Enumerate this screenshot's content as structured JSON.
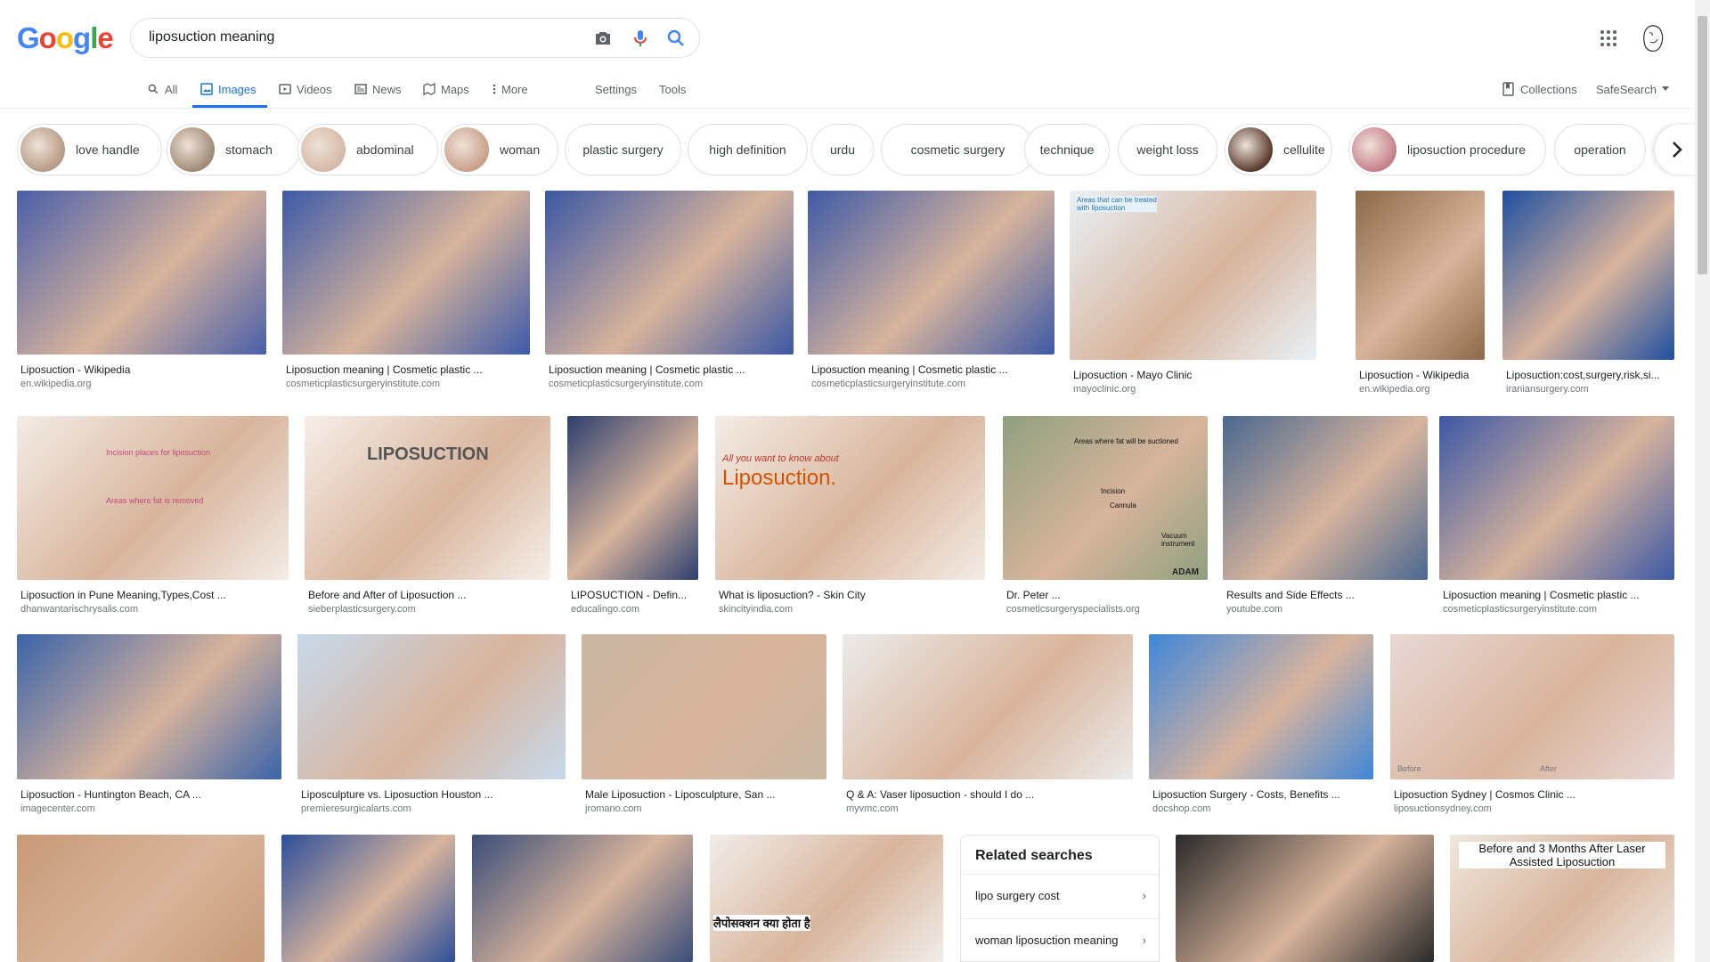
{
  "header": {
    "logo_letters": [
      "G",
      "o",
      "o",
      "g",
      "l",
      "e"
    ],
    "logo_colors": [
      "#4285F4",
      "#EA4335",
      "#FBBC05",
      "#4285F4",
      "#34A853",
      "#EA4335"
    ],
    "query": "liposuction meaning",
    "camera_icon": "camera-icon",
    "mic_icon": "mic-icon",
    "search_icon": "search-icon",
    "apps_icon": "apps-grid-icon",
    "avatar_icon": "avatar"
  },
  "nav": {
    "all": "All",
    "images": "Images",
    "videos": "Videos",
    "news": "News",
    "maps": "Maps",
    "more": "More",
    "settings": "Settings",
    "tools": "Tools",
    "collections": "Collections",
    "safesearch": "SafeSearch",
    "accent": "#1a73e8"
  },
  "chips": [
    {
      "label": "love handle",
      "thumb": "#b89a86"
    },
    {
      "label": "stomach",
      "thumb": "#9e8a76"
    },
    {
      "label": "abdominal",
      "thumb": "#d5b8a6"
    },
    {
      "label": "woman",
      "thumb": "#c9a08a"
    },
    {
      "label": "plastic surgery"
    },
    {
      "label": "high definition"
    },
    {
      "label": "urdu"
    },
    {
      "label": "cosmetic surgery"
    },
    {
      "label": "technique"
    },
    {
      "label": "weight loss"
    },
    {
      "label": "cellulite",
      "thumb": "#5a3a2e"
    },
    {
      "label": "liposuction procedure",
      "thumb": "#c77f8a"
    },
    {
      "label": "operation"
    }
  ],
  "results": [
    {
      "title": "Liposuction - Wikipedia",
      "domain": "en.wikipedia.org",
      "color": "#4a5fa8"
    },
    {
      "title": "Liposuction meaning | Cosmetic plastic ...",
      "domain": "cosmeticplasticsurgeryinstitute.com",
      "color": "#3d5aa8"
    },
    {
      "title": "Liposuction meaning | Cosmetic plastic ...",
      "domain": "cosmeticplasticsurgeryinstitute.com",
      "color": "#3b57a3"
    },
    {
      "title": "Liposuction meaning | Cosmetic plastic ...",
      "domain": "cosmeticplasticsurgeryinstitute.com",
      "color": "#3e5aa6"
    },
    {
      "title": "Liposuction - Mayo Clinic",
      "domain": "mayoclinic.org",
      "color": "#e9f1f7"
    },
    {
      "title": "Liposuction - Wikipedia",
      "domain": "en.wikipedia.org",
      "color": "#8a6a4a"
    },
    {
      "title": "Liposuction:cost,surgery,risk,si...",
      "domain": "iraniansurgery.com",
      "color": "#1f4fa0"
    },
    {
      "title": "Liposuction in Pune Meaning,Types,Cost ...",
      "domain": "dhanwantarischrysalis.com",
      "color": "#f3ece6"
    },
    {
      "title": "Before and After of Liposuction ...",
      "domain": "sieberplasticsurgery.com",
      "color": "#f6efe9"
    },
    {
      "title": "LIPOSUCTION - Defin...",
      "domain": "educalingo.com",
      "color": "#2c3f6e"
    },
    {
      "title": "What is liposuction? - Skin City",
      "domain": "skincityindia.com",
      "color": "#f4ede6"
    },
    {
      "title": "Dr. Peter ...",
      "domain": "cosmeticsurgeryspecialists.org",
      "color": "#8fa07f"
    },
    {
      "title": "Results and Side Effects ...",
      "domain": "youtube.com",
      "color": "#4a6890"
    },
    {
      "title": "Liposuction meaning | Cosmetic plastic ...",
      "domain": "cosmeticplasticsurgeryinstitute.com",
      "color": "#3c58a5"
    },
    {
      "title": "Liposuction - Huntington Beach, CA ...",
      "domain": "imagecenter.com",
      "color": "#3a63a8"
    },
    {
      "title": "Liposculpture vs. Liposuction Houston ...",
      "domain": "premieresurgicalarts.com",
      "color": "#c7d9ec"
    },
    {
      "title": "Male Liposuction - Liposculpture, San ...",
      "domain": "jromano.com",
      "color": "#c9b8a4"
    },
    {
      "title": "Q & A: Vaser liposuction - should I do ...",
      "domain": "myvmc.com",
      "color": "#ecebea"
    },
    {
      "title": "Liposuction Surgery - Costs, Benefits ...",
      "domain": "docshop.com",
      "color": "#3f86d8"
    },
    {
      "title": "Liposuction Sydney | Cosmos Clinic ...",
      "domain": "liposuctionsydney.com",
      "color": "#e8d8d6"
    },
    {
      "color": "#c89a78"
    },
    {
      "color": "#2d4f9a"
    },
    {
      "color": "#3a4e78"
    },
    {
      "color": "#f1ede9"
    },
    {
      "color": "#2a2a2a"
    },
    {
      "color": "#efe7df"
    }
  ],
  "image_text": {
    "mayo": "Areas that can be treated with liposuction",
    "lipo_banner": "LIPOSUCTION",
    "skin_city_intro": "All you want to know about",
    "skin_city_title": "Liposuction.",
    "adam_label": "ADAM",
    "incision_places": "Incision places for liposuction",
    "areas_removed": "Areas where fat is removed",
    "areas_suctioned": "Areas where fat will be suctioned",
    "incision": "Incision",
    "cannula": "Cannula",
    "vacuum": "Vacuum instrument",
    "before_label": "Before",
    "after_label": "After",
    "hindi_text": "लैपोसक्शन क्या होता है",
    "laser_caption": "Before and 3 Months After Laser Assisted Liposuction"
  },
  "related": {
    "title": "Related searches",
    "items": [
      {
        "label": "lipo surgery cost"
      },
      {
        "label": "woman liposuction meaning"
      }
    ]
  }
}
